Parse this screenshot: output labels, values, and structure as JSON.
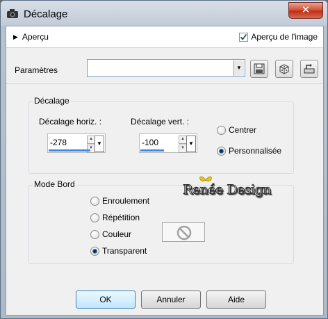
{
  "window": {
    "title": "Décalage",
    "close_label": "✕"
  },
  "preview": {
    "toggle_label": "Aperçu",
    "checkbox_label": "Aperçu de l'image",
    "checked": true
  },
  "params": {
    "label": "Paramètres",
    "preset_value": ""
  },
  "offset": {
    "group_label": "Décalage",
    "horiz_label": "Décalage horiz. :",
    "horiz_value": "-278",
    "vert_label": "Décalage vert. :",
    "vert_value": "-100",
    "options": [
      {
        "label": "Centrer",
        "selected": false
      },
      {
        "label": "Personnalisée",
        "selected": true
      }
    ]
  },
  "edge": {
    "group_label": "Mode Bord",
    "options": [
      {
        "label": "Enroulement",
        "selected": false
      },
      {
        "label": "Répétition",
        "selected": false
      },
      {
        "label": "Couleur",
        "selected": false
      },
      {
        "label": "Transparent",
        "selected": true
      }
    ]
  },
  "watermark": {
    "text": "Renée Design"
  },
  "buttons": {
    "ok": "OK",
    "cancel": "Annuler",
    "help": "Aide"
  },
  "colors": {
    "accent": "#3f8ae0",
    "radio_dot": "#0d2f5a",
    "close": "#c83a20"
  }
}
